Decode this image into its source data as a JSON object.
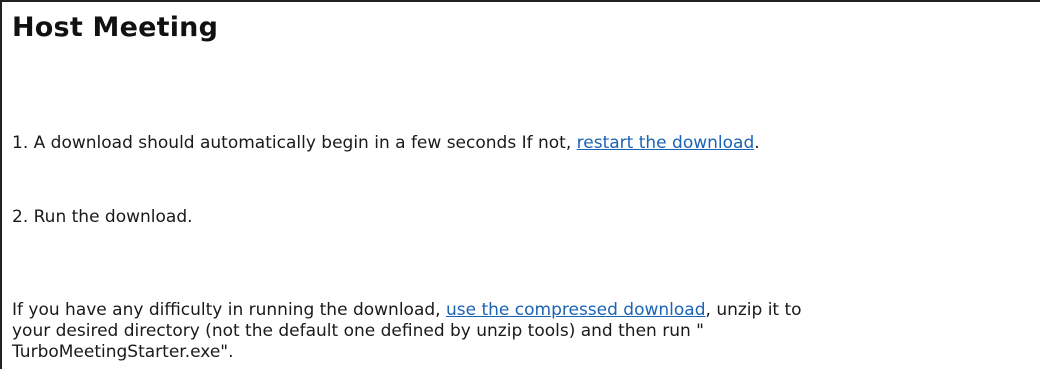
{
  "page": {
    "title": "Host Meeting"
  },
  "step1": {
    "prefix": "1. A download should automatically begin in a few seconds If not, ",
    "link": "restart the download",
    "suffix": "."
  },
  "step2": {
    "text": "2. Run the download."
  },
  "help": {
    "prefix": "If you have any difficulty in running the download, ",
    "link": "use the compressed download",
    "suffix_line1": ", unzip it to",
    "line2": "your desired directory (not the default one defined by unzip tools) and then run \"",
    "line3": "TurboMeetingStarter.exe\"."
  },
  "colors": {
    "link": "#1a63b5",
    "text": "#1a1a1a",
    "border": "#222222"
  }
}
